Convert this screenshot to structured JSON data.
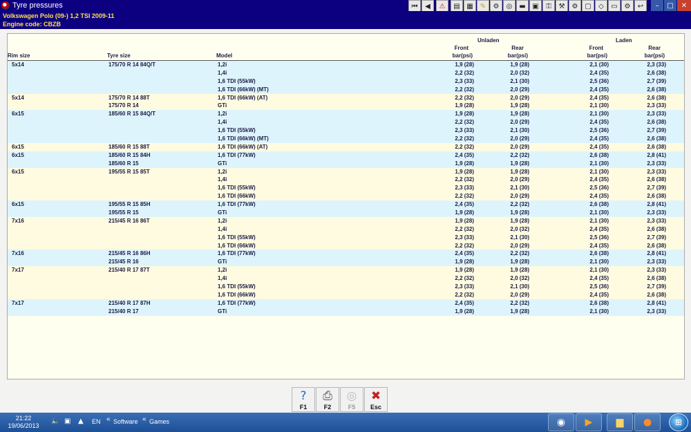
{
  "window": {
    "title": "Tyre pressures",
    "controls": {
      "minimize": "–",
      "maximize": "□",
      "close": "✕"
    }
  },
  "toolbar_icons": [
    {
      "name": "first-record-icon",
      "glyph": "⏮"
    },
    {
      "name": "previous-record-icon",
      "glyph": "◀"
    },
    {
      "name": "warning-icon",
      "glyph": "⚠"
    },
    {
      "name": "document-icon",
      "glyph": "▤"
    },
    {
      "name": "diagram-icon",
      "glyph": "▦"
    },
    {
      "name": "lubricant-icon",
      "glyph": "✎"
    },
    {
      "name": "engine-icon",
      "glyph": "⚙"
    },
    {
      "name": "wheel-icon",
      "glyph": "◎"
    },
    {
      "name": "battery-icon",
      "glyph": "▬"
    },
    {
      "name": "calendar-icon",
      "glyph": "▣"
    },
    {
      "name": "key-icon",
      "glyph": "⚿"
    },
    {
      "name": "tools-icon",
      "glyph": "⚒"
    },
    {
      "name": "gear-icon",
      "glyph": "⚙"
    },
    {
      "name": "frame-icon",
      "glyph": "▢"
    },
    {
      "name": "car-icon",
      "glyph": "◇"
    },
    {
      "name": "print-icon",
      "glyph": "▭"
    },
    {
      "name": "settings-icon",
      "glyph": "⚙"
    },
    {
      "name": "exit-icon",
      "glyph": "↩"
    }
  ],
  "vehicle": {
    "line1": "Volkswagen   Polo (09-) 1,2 TSI 2009-11",
    "line2": "Engine code: CBZB"
  },
  "columns": {
    "rim": "Rim size",
    "tyre": "Tyre size",
    "model": "Model",
    "unladen": "Unladen",
    "laden": "Laden",
    "front": "Front",
    "rear": "Rear",
    "unit": "bar(psi)"
  },
  "rows": [
    {
      "rim": "5x14",
      "tyre": "175/70 R 14 84Q/T",
      "model": "1,2i",
      "uf": "1,9 (28)",
      "ur": "1,9 (28)",
      "lf": "2,1 (30)",
      "lr": "2,3 (33)",
      "shade": "blue"
    },
    {
      "rim": "",
      "tyre": "",
      "model": "1,4i",
      "uf": "2,2 (32)",
      "ur": "2,0 (32)",
      "lf": "2,4 (35)",
      "lr": "2,6 (38)",
      "shade": "blue"
    },
    {
      "rim": "",
      "tyre": "",
      "model": "1,6 TDI (55kW)",
      "uf": "2,3 (33)",
      "ur": "2,1 (30)",
      "lf": "2,5 (36)",
      "lr": "2,7 (39)",
      "shade": "blue"
    },
    {
      "rim": "",
      "tyre": "",
      "model": "1,6 TDI (66kW) (MT)",
      "uf": "2,2 (32)",
      "ur": "2,0 (29)",
      "lf": "2,4 (35)",
      "lr": "2,6 (38)",
      "shade": "blue"
    },
    {
      "rim": "5x14",
      "tyre": "175/70 R 14 88T",
      "model": "1,6 TDI (66kW) (AT)",
      "uf": "2,2 (32)",
      "ur": "2,0 (29)",
      "lf": "2,4 (35)",
      "lr": "2,6 (38)",
      "shade": "yellow"
    },
    {
      "rim": "",
      "tyre": "175/70 R 14",
      "model": "GTi",
      "uf": "1,9 (28)",
      "ur": "1,9 (28)",
      "lf": "2,1 (30)",
      "lr": "2,3 (33)",
      "shade": "yellow"
    },
    {
      "rim": "6x15",
      "tyre": "185/60 R 15 84Q/T",
      "model": "1,2i",
      "uf": "1,9 (28)",
      "ur": "1,9 (28)",
      "lf": "2,1 (30)",
      "lr": "2,3 (33)",
      "shade": "blue"
    },
    {
      "rim": "",
      "tyre": "",
      "model": "1,4i",
      "uf": "2,2 (32)",
      "ur": "2,0 (29)",
      "lf": "2,4 (35)",
      "lr": "2,6 (38)",
      "shade": "blue"
    },
    {
      "rim": "",
      "tyre": "",
      "model": "1,6 TDI (55kW)",
      "uf": "2,3 (33)",
      "ur": "2,1 (30)",
      "lf": "2,5 (36)",
      "lr": "2,7 (39)",
      "shade": "blue"
    },
    {
      "rim": "",
      "tyre": "",
      "model": "1,6 TDI (66kW) (MT)",
      "uf": "2,2 (32)",
      "ur": "2,0 (29)",
      "lf": "2,4 (35)",
      "lr": "2,6 (38)",
      "shade": "blue"
    },
    {
      "rim": "6x15",
      "tyre": "185/60 R 15 88T",
      "model": "1,6 TDI (66kW) (AT)",
      "uf": "2,2 (32)",
      "ur": "2,0 (29)",
      "lf": "2,4 (35)",
      "lr": "2,6 (38)",
      "shade": "yellow"
    },
    {
      "rim": "6x15",
      "tyre": "185/60 R 15 84H",
      "model": "1,6 TDI (77kW)",
      "uf": "2,4 (35)",
      "ur": "2,2 (32)",
      "lf": "2,6 (38)",
      "lr": "2,8 (41)",
      "shade": "blue"
    },
    {
      "rim": "",
      "tyre": "185/60 R 15",
      "model": "GTi",
      "uf": "1,9 (28)",
      "ur": "1,9 (28)",
      "lf": "2,1 (30)",
      "lr": "2,3 (33)",
      "shade": "blue"
    },
    {
      "rim": "6x15",
      "tyre": "195/55 R 15 85T",
      "model": "1,2i",
      "uf": "1,9 (28)",
      "ur": "1,9 (28)",
      "lf": "2,1 (30)",
      "lr": "2,3 (33)",
      "shade": "yellow"
    },
    {
      "rim": "",
      "tyre": "",
      "model": "1,4i",
      "uf": "2,2 (32)",
      "ur": "2,0 (29)",
      "lf": "2,4 (35)",
      "lr": "2,6 (38)",
      "shade": "yellow"
    },
    {
      "rim": "",
      "tyre": "",
      "model": "1,6 TDI (55kW)",
      "uf": "2,3 (33)",
      "ur": "2,1 (30)",
      "lf": "2,5 (36)",
      "lr": "2,7 (39)",
      "shade": "yellow"
    },
    {
      "rim": "",
      "tyre": "",
      "model": "1,6 TDI (66kW)",
      "uf": "2,2 (32)",
      "ur": "2,0 (29)",
      "lf": "2,4 (35)",
      "lr": "2,6 (38)",
      "shade": "yellow"
    },
    {
      "rim": "6x15",
      "tyre": "195/55 R 15 85H",
      "model": "1,6 TDI (77kW)",
      "uf": "2,4 (35)",
      "ur": "2,2 (32)",
      "lf": "2,6 (38)",
      "lr": "2,8 (41)",
      "shade": "blue"
    },
    {
      "rim": "",
      "tyre": "195/55 R 15",
      "model": "GTi",
      "uf": "1,9 (28)",
      "ur": "1,9 (28)",
      "lf": "2,1 (30)",
      "lr": "2,3 (33)",
      "shade": "blue"
    },
    {
      "rim": "7x16",
      "tyre": "215/45 R 16 86T",
      "model": "1,2i",
      "uf": "1,9 (28)",
      "ur": "1,9 (28)",
      "lf": "2,1 (30)",
      "lr": "2,3 (33)",
      "shade": "yellow"
    },
    {
      "rim": "",
      "tyre": "",
      "model": "1,4i",
      "uf": "2,2 (32)",
      "ur": "2,0 (32)",
      "lf": "2,4 (35)",
      "lr": "2,6 (38)",
      "shade": "yellow"
    },
    {
      "rim": "",
      "tyre": "",
      "model": "1,6 TDI (55kW)",
      "uf": "2,3 (33)",
      "ur": "2,1 (30)",
      "lf": "2,5 (36)",
      "lr": "2,7 (39)",
      "shade": "yellow"
    },
    {
      "rim": "",
      "tyre": "",
      "model": "1,6 TDI (66kW)",
      "uf": "2,2 (32)",
      "ur": "2,0 (29)",
      "lf": "2,4 (35)",
      "lr": "2,6 (38)",
      "shade": "yellow"
    },
    {
      "rim": "7x16",
      "tyre": "215/45 R 16 86H",
      "model": "1,6 TDI (77kW)",
      "uf": "2,4 (35)",
      "ur": "2,2 (32)",
      "lf": "2,6 (38)",
      "lr": "2,8 (41)",
      "shade": "blue"
    },
    {
      "rim": "",
      "tyre": "215/45 R 16",
      "model": "GTi",
      "uf": "1,9 (28)",
      "ur": "1,9 (28)",
      "lf": "2,1 (30)",
      "lr": "2,3 (33)",
      "shade": "blue"
    },
    {
      "rim": "7x17",
      "tyre": "215/40 R 17 87T",
      "model": "1,2i",
      "uf": "1,9 (28)",
      "ur": "1,9 (28)",
      "lf": "2,1 (30)",
      "lr": "2,3 (33)",
      "shade": "yellow"
    },
    {
      "rim": "",
      "tyre": "",
      "model": "1,4i",
      "uf": "2,2 (32)",
      "ur": "2,0 (32)",
      "lf": "2,4 (35)",
      "lr": "2,6 (38)",
      "shade": "yellow"
    },
    {
      "rim": "",
      "tyre": "",
      "model": "1,6 TDI (55kW)",
      "uf": "2,3 (33)",
      "ur": "2,1 (30)",
      "lf": "2,5 (36)",
      "lr": "2,7 (39)",
      "shade": "yellow"
    },
    {
      "rim": "",
      "tyre": "",
      "model": "1,6 TDI (66kW)",
      "uf": "2,2 (32)",
      "ur": "2,0 (29)",
      "lf": "2,4 (35)",
      "lr": "2,6 (38)",
      "shade": "yellow"
    },
    {
      "rim": "7x17",
      "tyre": "215/40 R 17 87H",
      "model": "1,6 TDI (77kW)",
      "uf": "2,4 (35)",
      "ur": "2,2 (32)",
      "lf": "2,6 (38)",
      "lr": "2,8 (41)",
      "shade": "blue"
    },
    {
      "rim": "",
      "tyre": "215/40 R 17",
      "model": "GTi",
      "uf": "1,9 (28)",
      "ur": "1,9 (28)",
      "lf": "2,1 (30)",
      "lr": "2,3 (33)",
      "shade": "blue"
    }
  ],
  "fkeys": [
    {
      "label": "F1",
      "icon": "help-icon",
      "glyph": "?",
      "disabled": false
    },
    {
      "label": "F2",
      "icon": "print-icon",
      "glyph": "⎙",
      "disabled": false
    },
    {
      "label": "F5",
      "icon": "tyre-pressure-icon",
      "glyph": "◎",
      "disabled": true
    },
    {
      "label": "Esc",
      "icon": "exit-icon",
      "glyph": "✖",
      "disabled": false
    }
  ],
  "taskbar": {
    "time": "21:22",
    "date": "19/06/2013",
    "language": "EN",
    "toolbars": [
      "Software",
      "Games"
    ],
    "tray_icons": [
      "volume-icon",
      "network-icon",
      "show-hidden-icon"
    ],
    "tasks": [
      "media-center-icon",
      "media-player-icon",
      "file-explorer-icon",
      "firefox-icon"
    ],
    "start": "windows-start-icon"
  },
  "colors": {
    "header_bg": "#0d0080",
    "header_text": "#ffe14a",
    "row_blue": "#def4fc",
    "row_yellow": "#fffbe0",
    "table_bg": "#fffff0"
  }
}
